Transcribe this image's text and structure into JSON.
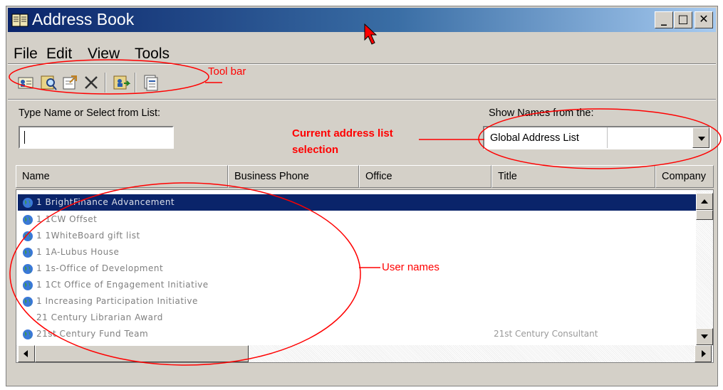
{
  "window": {
    "title": "Address Book"
  },
  "menu": [
    "File",
    "Edit",
    "View",
    "Tools"
  ],
  "toolbar": {
    "buttons": [
      "new-entry-icon",
      "find-people-icon",
      "properties-icon",
      "delete-icon",
      "add-to-contacts-icon",
      "address-list-icon"
    ]
  },
  "search": {
    "label": "Type Name or Select from List:",
    "value": ""
  },
  "source": {
    "label": "Show Names from the:",
    "selected": "Global Address List"
  },
  "columns": [
    "Name",
    "Business Phone",
    "Office",
    "Title",
    "Company"
  ],
  "rows": [
    {
      "name": "1 BrightFinance Advancement",
      "title": "",
      "icon": "globe-icon",
      "selected": true
    },
    {
      "name": "1 1CW Offset",
      "title": "",
      "icon": "globe-icon",
      "selected": false
    },
    {
      "name": "1 1WhiteBoard gift list",
      "title": "",
      "icon": "globe-icon",
      "selected": false
    },
    {
      "name": "1 1A-Lubus House",
      "title": "",
      "icon": "globe-icon",
      "selected": false
    },
    {
      "name": "1 1s-Office of Development",
      "title": "",
      "icon": "globe-icon",
      "selected": false
    },
    {
      "name": "1 1Ct Office of Engagement Initiative",
      "title": "",
      "icon": "globe-icon",
      "selected": false
    },
    {
      "name": "1 Increasing Participation Initiative",
      "title": "",
      "icon": "globe-icon",
      "selected": false
    },
    {
      "name": "21 Century Librarian Award",
      "title": "",
      "icon": "",
      "selected": false
    },
    {
      "name": "21st Century Fund Team",
      "title": "21st Century Consultant",
      "icon": "globe-icon",
      "selected": false
    }
  ],
  "annotations": {
    "toolbar": "Tool bar",
    "address_list_line1": "Current address list",
    "address_list_line2": "selection",
    "user_names": "User names",
    "color": "#ff0000"
  },
  "colors": {
    "titlebar_start": "#0a246a",
    "titlebar_end": "#a6caf0",
    "selection": "#0a246a",
    "chrome": "#d4d0c8"
  }
}
